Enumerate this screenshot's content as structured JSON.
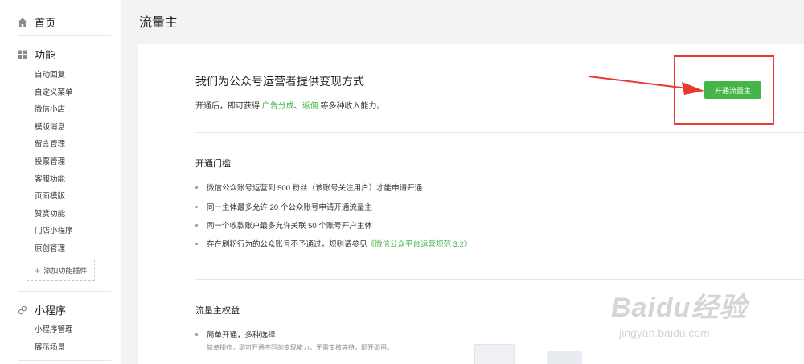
{
  "sidebar": {
    "home": "首页",
    "features": {
      "title": "功能",
      "items": [
        "自动回复",
        "自定义菜单",
        "微信小店",
        "模版消息",
        "留言管理",
        "投票管理",
        "客服功能",
        "页面模版",
        "赞赏功能",
        "门店小程序",
        "原创管理"
      ],
      "add_plugin": "添加功能插件"
    },
    "miniprogram": {
      "title": "小程序",
      "items": [
        "小程序管理",
        "展示场景"
      ]
    }
  },
  "page_title": "流量主",
  "main": {
    "title": "我们为公众号运营者提供变现方式",
    "sub_prefix": "开通后，即可获得 ",
    "sub_link1": "广告分成",
    "sub_sep": "、",
    "sub_link2": "返佣",
    "sub_suffix": " 等多种收入能力。",
    "open_button": "开通流量主",
    "threshold_title": "开通门槛",
    "threshold_items": [
      "微信公众账号运营到 500 粉丝（该账号关注用户）才能申请开通",
      "同一主体最多允许 20 个公众账号申请开通流量主",
      "同一个收款账户最多允许关联 50 个账号开户主体"
    ],
    "threshold_last_prefix": "存在刷粉行为的公众账号不予通过，规则请参见",
    "threshold_last_link": "《微信公众平台运营规范 3.2》",
    "rights_title": "流量主权益",
    "rights_item": "简单开通，多种选择",
    "rights_desc": "简单操作，即可开通不同的变现能力，无需审核等待，即开即用。"
  },
  "watermark": {
    "brand": "Baidu经验",
    "url": "jingyan.baidu.com"
  },
  "colors": {
    "accent_green": "#44b549",
    "annotation_red": "#e93a2f"
  },
  "icons": {
    "home": "home-icon",
    "features": "grid-icon",
    "miniprogram": "link-icon",
    "add": "plus-icon"
  }
}
